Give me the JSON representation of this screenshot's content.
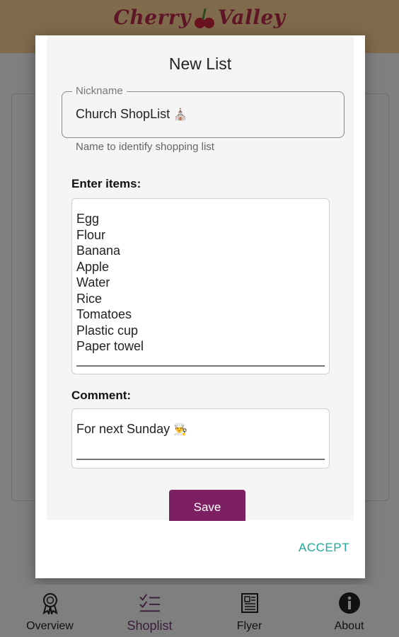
{
  "app": {
    "logo_part1": "Cherry",
    "logo_part2": "Valley"
  },
  "dialog": {
    "title": "New List",
    "nickname_label": "Nickname",
    "nickname_value": "Church ShopList",
    "nickname_emoji": "⛪",
    "nickname_helper": "Name to identify shopping list",
    "items_label": "Enter items:",
    "items": [
      "Egg",
      "Flour",
      "Banana",
      "Apple",
      "Water",
      "Rice",
      "Tomatoes",
      "Plastic cup",
      "Paper towel"
    ],
    "comment_label": "Comment:",
    "comment_value": "For next Sunday",
    "comment_emoji": "👨‍🍳",
    "save_label": "Save",
    "accept_label": "ACCEPT"
  },
  "bottom_nav": {
    "items": [
      {
        "label": "Overview",
        "icon": "award-ribbon-icon"
      },
      {
        "label": "Shoplist",
        "icon": "checklist-icon",
        "active": true
      },
      {
        "label": "Flyer",
        "icon": "newspaper-icon"
      },
      {
        "label": "About",
        "icon": "info-icon"
      }
    ]
  },
  "colors": {
    "accent": "#7c1f63",
    "accept_text": "#1fa89a",
    "scrim": "#7f7f7f"
  }
}
